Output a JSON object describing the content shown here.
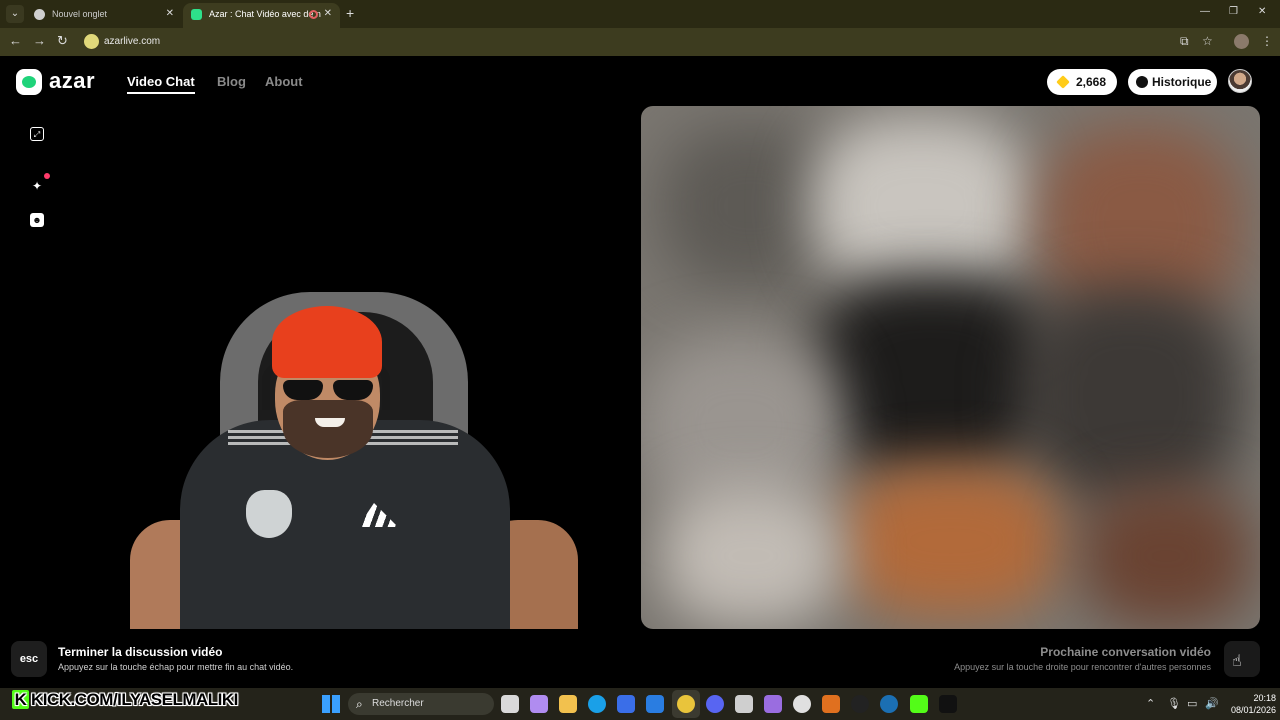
{
  "browser": {
    "tabs": [
      {
        "title": "Nouvel onglet"
      },
      {
        "title": "Azar : Chat Vidéo avec de n"
      }
    ],
    "url": "azarlive.com"
  },
  "site": {
    "logo": "azar",
    "nav": [
      {
        "label": "Video Chat"
      },
      {
        "label": "Blog"
      },
      {
        "label": "About"
      }
    ],
    "gems": "2,668",
    "history_label": "Historique"
  },
  "bottom": {
    "esc_key": "esc",
    "end_title": "Terminer la discussion vidéo",
    "end_sub": "Appuyez sur la touche échap pour mettre fin au chat vidéo.",
    "next_title": "Prochaine conversation vidéo",
    "next_sub": "Appuyez sur la touche droite pour rencontrer d'autres personnes"
  },
  "stream_overlay": {
    "text": "KICK.COM/ILYASELMALIKI"
  },
  "taskbar": {
    "search_placeholder": "Rechercher",
    "time": "20:18",
    "date": "08/01/2026"
  },
  "colors": {
    "accent": "#1fd37a",
    "gem": "#ffcc19",
    "kick": "#53fc18"
  }
}
